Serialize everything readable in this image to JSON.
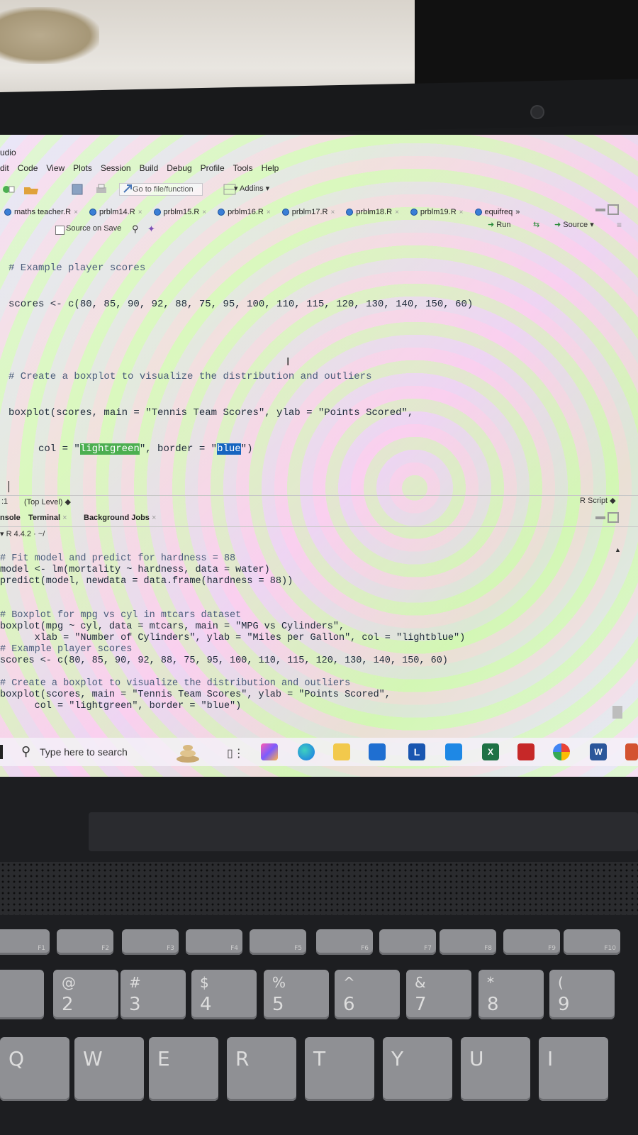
{
  "app": {
    "title_fragment": "udio"
  },
  "menu": [
    "dit",
    "Code",
    "View",
    "Plots",
    "Session",
    "Build",
    "Debug",
    "Profile",
    "Tools",
    "Help"
  ],
  "toolbar": {
    "goto_placeholder": "Go to file/function",
    "addins_label": "Addins"
  },
  "tabs": [
    {
      "label": "maths teacher.R"
    },
    {
      "label": "prblm14.R"
    },
    {
      "label": "prblm15.R"
    },
    {
      "label": "prblm16.R"
    },
    {
      "label": "prblm17.R"
    },
    {
      "label": "prblm18.R"
    },
    {
      "label": "prblm19.R"
    },
    {
      "label": "equifreq"
    }
  ],
  "editor_toolbar": {
    "source_on_save": "Source on Save",
    "run": "Run",
    "source": "Source"
  },
  "editor_lines": [
    "# Example player scores",
    "scores <- c(80, 85, 90, 92, 88, 75, 95, 100, 110, 115, 120, 130, 140, 150, 60)",
    "",
    "# Create a boxplot to visualize the distribution and outliers",
    "boxplot(scores, main = \"Tennis Team Scores\", ylab = \"Points Scored\","
  ],
  "editor_line6": {
    "prefix": "     col = \"",
    "green": "lightgreen",
    "mid": "\", border = \"",
    "blue": "blue",
    "suffix": "\")"
  },
  "status": {
    "position": ":1",
    "scope": "(Top Level)",
    "filetype": "R Script"
  },
  "console_tabs": [
    "nsole",
    "Terminal",
    "Background Jobs"
  ],
  "console_version": "R 4.4.2 · ~/",
  "console_lines": [
    "# Fit model and predict for hardness = 88",
    "model <- lm(mortality ~ hardness, data = water)",
    "predict(model, newdata = data.frame(hardness = 88))",
    "",
    "",
    "# Boxplot for mpg vs cyl in mtcars dataset",
    "boxplot(mpg ~ cyl, data = mtcars, main = \"MPG vs Cylinders\",",
    "      xlab = \"Number of Cylinders\", ylab = \"Miles per Gallon\", col = \"lightblue\")",
    "# Example player scores",
    "scores <- c(80, 85, 90, 92, 88, 75, 95, 100, 110, 115, 120, 130, 140, 150, 60)",
    "",
    "# Create a boxplot to visualize the distribution and outliers",
    "boxplot(scores, main = \"Tennis Team Scores\", ylab = \"Points Scored\",",
    "      col = \"lightgreen\", border = \"blue\")"
  ],
  "taskbar": {
    "search_placeholder": "Type here to search"
  },
  "keyboard": {
    "fkeys": [
      "F1",
      "F2",
      "F3",
      "F4",
      "F5",
      "F6",
      "F7",
      "F8",
      "F9",
      "F10"
    ],
    "numkeys": [
      {
        "top": "!",
        "bot": ""
      },
      {
        "top": "@",
        "bot": "2"
      },
      {
        "top": "#",
        "bot": "3"
      },
      {
        "top": "$",
        "bot": "4"
      },
      {
        "top": "%",
        "bot": "5"
      },
      {
        "top": "^",
        "bot": "6"
      },
      {
        "top": "&",
        "bot": "7"
      },
      {
        "top": "*",
        "bot": "8"
      },
      {
        "top": "(",
        "bot": "9"
      }
    ],
    "letters": [
      "Q",
      "W",
      "E",
      "R",
      "T",
      "Y",
      "U",
      "I"
    ]
  }
}
